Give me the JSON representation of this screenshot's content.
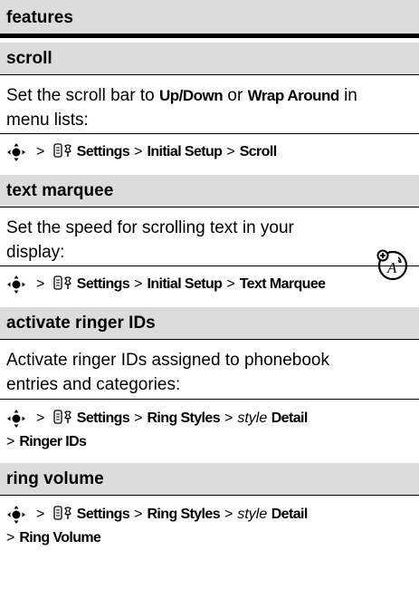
{
  "header": {
    "title": "features"
  },
  "sections": {
    "scroll": {
      "title": "scroll",
      "desc": {
        "pre": "Set the scroll bar to ",
        "opt1": "Up/Down",
        "mid": " or ",
        "opt2": "Wrap Around",
        "post1": " in",
        "line2": "menu lists:"
      },
      "path": [
        "Settings",
        "Initial Setup",
        "Scroll"
      ]
    },
    "text_marquee": {
      "title": "text marquee",
      "desc": [
        "Set the speed for scrolling text in your",
        "display:"
      ],
      "path": [
        "Settings",
        "Initial Setup",
        "Text Marquee"
      ],
      "icon": "network-feature-icon"
    },
    "ringer_ids": {
      "title": "activate ringer IDs",
      "desc": [
        "Activate ringer IDs assigned to phonebook",
        "entries and categories:"
      ],
      "path": [
        "Settings",
        "Ring Styles",
        "style",
        "Detail",
        "Ringer IDs"
      ]
    },
    "ring_volume": {
      "title": "ring volume",
      "path": [
        "Settings",
        "Ring Styles",
        "style",
        "Detail",
        "Ring Volume"
      ]
    }
  },
  "symbols": {
    "gt": ">",
    "nav_icon": "nav-key-icon",
    "settings_icon": "settings-icon"
  }
}
